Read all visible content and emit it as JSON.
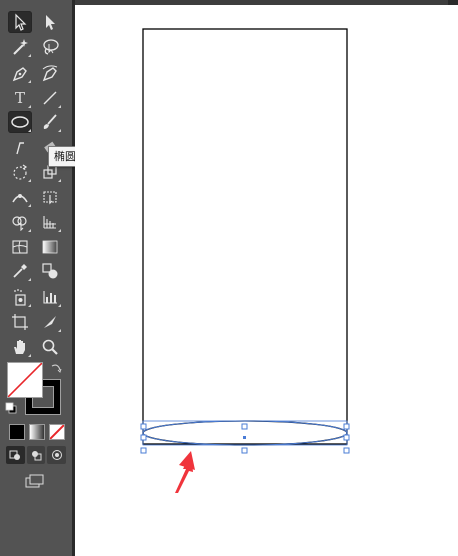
{
  "tooltip": {
    "text": "椭圆工具 (L)"
  },
  "toolbar": {
    "tools": [
      {
        "name": "selection-tool-icon",
        "label": ""
      },
      {
        "name": "direct-selection-tool-icon",
        "label": ""
      },
      {
        "name": "magic-wand-tool-icon",
        "label": ""
      },
      {
        "name": "lasso-tool-icon",
        "label": ""
      },
      {
        "name": "pen-tool-icon",
        "label": ""
      },
      {
        "name": "curvature-tool-icon",
        "label": ""
      },
      {
        "name": "type-tool-icon",
        "label": "T"
      },
      {
        "name": "line-segment-tool-icon",
        "label": ""
      },
      {
        "name": "ellipse-tool-icon",
        "label": ""
      },
      {
        "name": "paintbrush-tool-icon",
        "label": ""
      }
    ],
    "selected_tool": "ellipse-tool"
  },
  "colors": {
    "fill": "none",
    "stroke": "#000000",
    "accent_selection": "#4a7cd6",
    "arrow_annotation": "#f0343c"
  },
  "canvas": {
    "background": "#ffffff"
  }
}
